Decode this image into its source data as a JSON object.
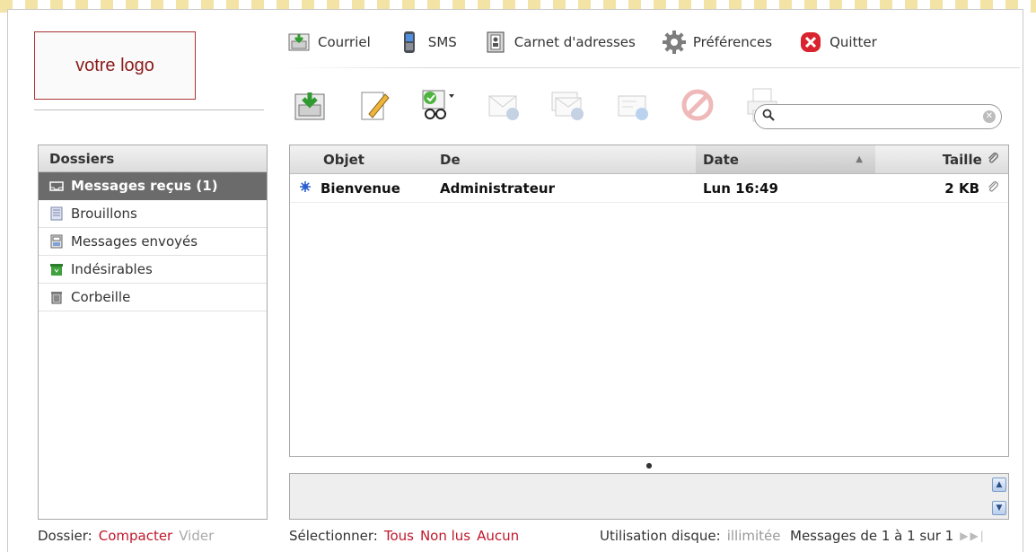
{
  "logo": {
    "text": "votre logo"
  },
  "taskbar": [
    {
      "label": "Courriel",
      "icon": "mail-inbox-icon"
    },
    {
      "label": "SMS",
      "icon": "phone-icon"
    },
    {
      "label": "Carnet d'adresses",
      "icon": "address-book-icon"
    },
    {
      "label": "Préférences",
      "icon": "gear-icon"
    },
    {
      "label": "Quitter",
      "icon": "close-icon"
    }
  ],
  "toolbar": [
    {
      "name": "check-mail",
      "icon": "receive-mail-icon",
      "enabled": true
    },
    {
      "name": "compose",
      "icon": "pencil-icon",
      "enabled": true
    },
    {
      "name": "mark",
      "icon": "read-mark-icon",
      "enabled": true
    },
    {
      "name": "reply",
      "icon": "reply-icon",
      "enabled": false
    },
    {
      "name": "reply-all",
      "icon": "reply-all-icon",
      "enabled": false
    },
    {
      "name": "forward",
      "icon": "forward-icon",
      "enabled": false
    },
    {
      "name": "delete",
      "icon": "delete-icon",
      "enabled": false
    },
    {
      "name": "print",
      "icon": "print-icon",
      "enabled": false
    }
  ],
  "search": {
    "value": "",
    "placeholder": ""
  },
  "folders": {
    "header": "Dossiers",
    "items": [
      {
        "label": "Messages reçus (1)",
        "icon": "inbox-icon",
        "selected": true
      },
      {
        "label": "Brouillons",
        "icon": "drafts-icon",
        "selected": false
      },
      {
        "label": "Messages envoyés",
        "icon": "sent-icon",
        "selected": false
      },
      {
        "label": "Indésirables",
        "icon": "junk-icon",
        "selected": false
      },
      {
        "label": "Corbeille",
        "icon": "trash-icon",
        "selected": false
      }
    ]
  },
  "messages": {
    "columns": {
      "subject": "Objet",
      "from": "De",
      "date": "Date",
      "size": "Taille"
    },
    "rows": [
      {
        "subject": "Bienvenue",
        "from": "Administrateur",
        "date": "Lun 16:49",
        "size": "2 KB",
        "unread": true
      }
    ]
  },
  "footer": {
    "folder_label": "Dossier:",
    "compact": "Compacter",
    "empty": "Vider",
    "select_label": "Sélectionner:",
    "select_all": "Tous",
    "select_unread": "Non lus",
    "select_none": "Aucun",
    "quota_label": "Utilisation disque:",
    "quota_value": "illimitée",
    "pager": "Messages de 1 à 1 sur 1"
  },
  "colors": {
    "accent": "#c0172b",
    "selected_folder": "#6b6b6b"
  }
}
